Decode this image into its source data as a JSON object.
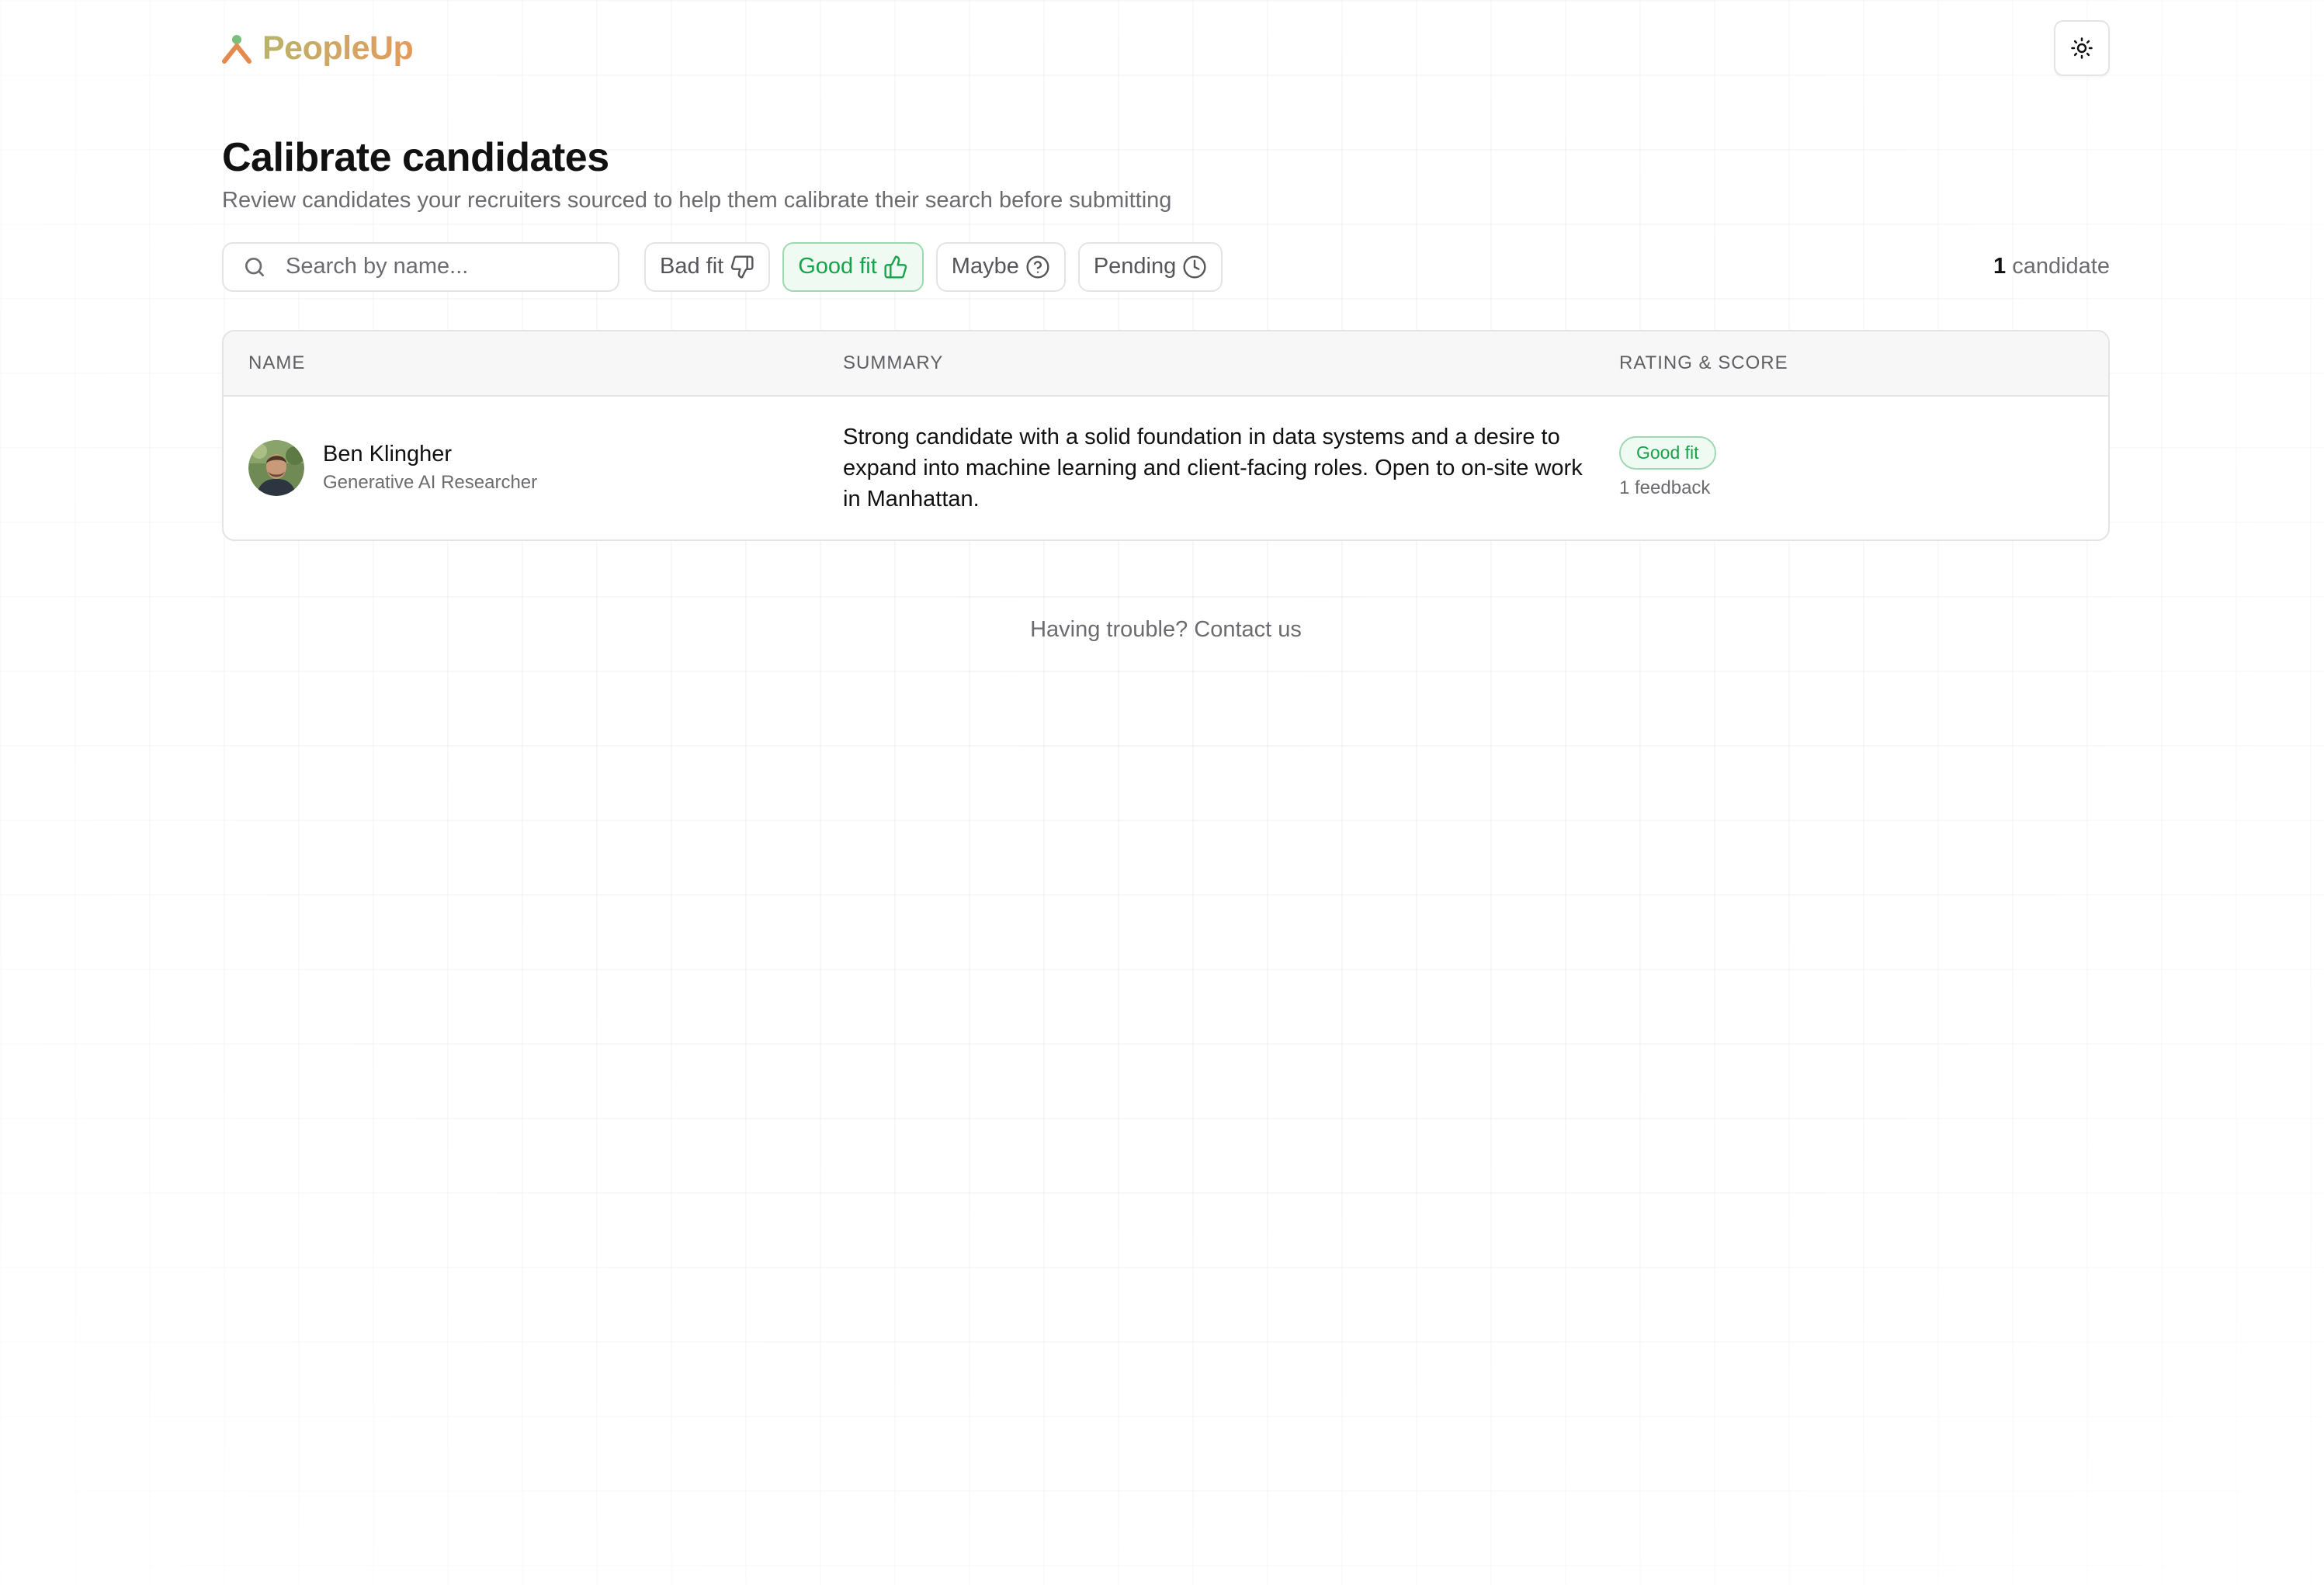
{
  "app": {
    "name": "PeopleUp"
  },
  "header": {
    "title": "Calibrate candidates",
    "subtitle": "Review candidates your recruiters sourced to help them calibrate their search before submitting",
    "theme_toggle_icon": "sun-icon"
  },
  "search": {
    "placeholder": "Search by name...",
    "value": ""
  },
  "filters": [
    {
      "label": "Bad fit",
      "icon": "thumbs-down-icon",
      "active": false
    },
    {
      "label": "Good fit",
      "icon": "thumbs-up-icon",
      "active": true
    },
    {
      "label": "Maybe",
      "icon": "help-circle-icon",
      "active": false
    },
    {
      "label": "Pending",
      "icon": "clock-icon",
      "active": false
    }
  ],
  "count": {
    "number": "1",
    "label": "candidate"
  },
  "table": {
    "columns": [
      "NAME",
      "SUMMARY",
      "RATING & SCORE"
    ],
    "rows": [
      {
        "name": "Ben Klingher",
        "role": "Generative AI Researcher",
        "summary": "Strong candidate with a solid foundation in data systems and a desire to expand into machine learning and client-facing roles. Open to on-site work in Manhattan.",
        "rating": "Good fit",
        "feedback": "1 feedback"
      }
    ]
  },
  "footer": {
    "prefix": "Having trouble?",
    "link": "Contact us"
  },
  "colors": {
    "accent_green": "#16a34a",
    "brand_start": "#b9b36a",
    "brand_end": "#e59a5b"
  }
}
